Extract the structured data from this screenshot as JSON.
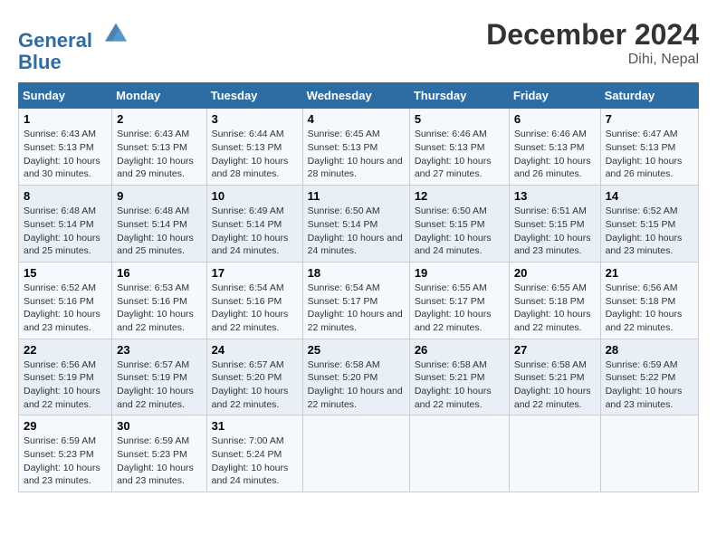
{
  "header": {
    "logo_line1": "General",
    "logo_line2": "Blue",
    "month": "December 2024",
    "location": "Dihi, Nepal"
  },
  "days_of_week": [
    "Sunday",
    "Monday",
    "Tuesday",
    "Wednesday",
    "Thursday",
    "Friday",
    "Saturday"
  ],
  "weeks": [
    [
      {
        "day": "1",
        "sunrise": "6:43 AM",
        "sunset": "5:13 PM",
        "daylight": "10 hours and 30 minutes."
      },
      {
        "day": "2",
        "sunrise": "6:43 AM",
        "sunset": "5:13 PM",
        "daylight": "10 hours and 29 minutes."
      },
      {
        "day": "3",
        "sunrise": "6:44 AM",
        "sunset": "5:13 PM",
        "daylight": "10 hours and 28 minutes."
      },
      {
        "day": "4",
        "sunrise": "6:45 AM",
        "sunset": "5:13 PM",
        "daylight": "10 hours and 28 minutes."
      },
      {
        "day": "5",
        "sunrise": "6:46 AM",
        "sunset": "5:13 PM",
        "daylight": "10 hours and 27 minutes."
      },
      {
        "day": "6",
        "sunrise": "6:46 AM",
        "sunset": "5:13 PM",
        "daylight": "10 hours and 26 minutes."
      },
      {
        "day": "7",
        "sunrise": "6:47 AM",
        "sunset": "5:13 PM",
        "daylight": "10 hours and 26 minutes."
      }
    ],
    [
      {
        "day": "8",
        "sunrise": "6:48 AM",
        "sunset": "5:14 PM",
        "daylight": "10 hours and 25 minutes."
      },
      {
        "day": "9",
        "sunrise": "6:48 AM",
        "sunset": "5:14 PM",
        "daylight": "10 hours and 25 minutes."
      },
      {
        "day": "10",
        "sunrise": "6:49 AM",
        "sunset": "5:14 PM",
        "daylight": "10 hours and 24 minutes."
      },
      {
        "day": "11",
        "sunrise": "6:50 AM",
        "sunset": "5:14 PM",
        "daylight": "10 hours and 24 minutes."
      },
      {
        "day": "12",
        "sunrise": "6:50 AM",
        "sunset": "5:15 PM",
        "daylight": "10 hours and 24 minutes."
      },
      {
        "day": "13",
        "sunrise": "6:51 AM",
        "sunset": "5:15 PM",
        "daylight": "10 hours and 23 minutes."
      },
      {
        "day": "14",
        "sunrise": "6:52 AM",
        "sunset": "5:15 PM",
        "daylight": "10 hours and 23 minutes."
      }
    ],
    [
      {
        "day": "15",
        "sunrise": "6:52 AM",
        "sunset": "5:16 PM",
        "daylight": "10 hours and 23 minutes."
      },
      {
        "day": "16",
        "sunrise": "6:53 AM",
        "sunset": "5:16 PM",
        "daylight": "10 hours and 22 minutes."
      },
      {
        "day": "17",
        "sunrise": "6:54 AM",
        "sunset": "5:16 PM",
        "daylight": "10 hours and 22 minutes."
      },
      {
        "day": "18",
        "sunrise": "6:54 AM",
        "sunset": "5:17 PM",
        "daylight": "10 hours and 22 minutes."
      },
      {
        "day": "19",
        "sunrise": "6:55 AM",
        "sunset": "5:17 PM",
        "daylight": "10 hours and 22 minutes."
      },
      {
        "day": "20",
        "sunrise": "6:55 AM",
        "sunset": "5:18 PM",
        "daylight": "10 hours and 22 minutes."
      },
      {
        "day": "21",
        "sunrise": "6:56 AM",
        "sunset": "5:18 PM",
        "daylight": "10 hours and 22 minutes."
      }
    ],
    [
      {
        "day": "22",
        "sunrise": "6:56 AM",
        "sunset": "5:19 PM",
        "daylight": "10 hours and 22 minutes."
      },
      {
        "day": "23",
        "sunrise": "6:57 AM",
        "sunset": "5:19 PM",
        "daylight": "10 hours and 22 minutes."
      },
      {
        "day": "24",
        "sunrise": "6:57 AM",
        "sunset": "5:20 PM",
        "daylight": "10 hours and 22 minutes."
      },
      {
        "day": "25",
        "sunrise": "6:58 AM",
        "sunset": "5:20 PM",
        "daylight": "10 hours and 22 minutes."
      },
      {
        "day": "26",
        "sunrise": "6:58 AM",
        "sunset": "5:21 PM",
        "daylight": "10 hours and 22 minutes."
      },
      {
        "day": "27",
        "sunrise": "6:58 AM",
        "sunset": "5:21 PM",
        "daylight": "10 hours and 22 minutes."
      },
      {
        "day": "28",
        "sunrise": "6:59 AM",
        "sunset": "5:22 PM",
        "daylight": "10 hours and 23 minutes."
      }
    ],
    [
      {
        "day": "29",
        "sunrise": "6:59 AM",
        "sunset": "5:23 PM",
        "daylight": "10 hours and 23 minutes."
      },
      {
        "day": "30",
        "sunrise": "6:59 AM",
        "sunset": "5:23 PM",
        "daylight": "10 hours and 23 minutes."
      },
      {
        "day": "31",
        "sunrise": "7:00 AM",
        "sunset": "5:24 PM",
        "daylight": "10 hours and 24 minutes."
      },
      null,
      null,
      null,
      null
    ]
  ]
}
